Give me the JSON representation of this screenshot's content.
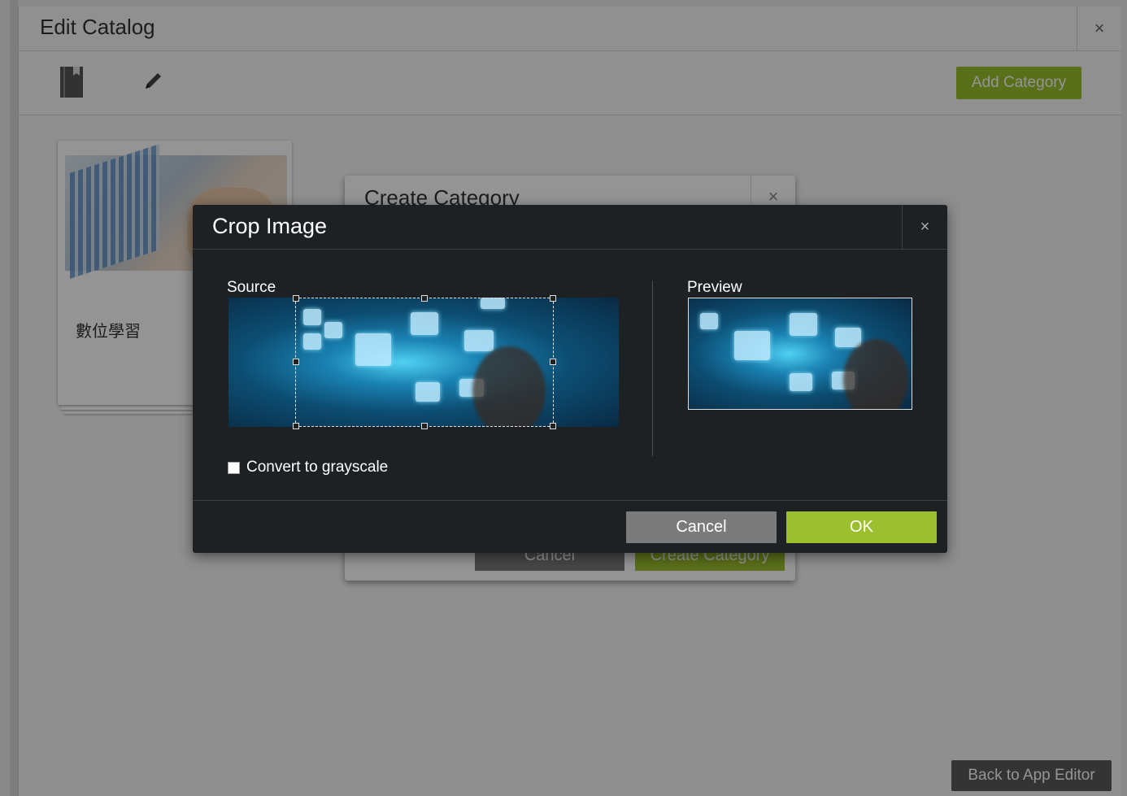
{
  "edit_catalog": {
    "title": "Edit Catalog",
    "close": "×",
    "add_category_label": "Add Category",
    "book_icon": "book-icon",
    "pencil_icon": "pencil-icon",
    "card_label": "數位學習",
    "back_label": "Back to App Editor"
  },
  "create_category": {
    "title": "Create Category",
    "close": "×",
    "cancel_label": "Cancel",
    "create_label": "Create Category"
  },
  "crop_image": {
    "title": "Crop Image",
    "close": "×",
    "source_label": "Source",
    "preview_label": "Preview",
    "grayscale_label": "Convert to grayscale",
    "grayscale_checked": false,
    "cancel_label": "Cancel",
    "ok_label": "OK"
  },
  "colors": {
    "accent_green": "#9bbf2e",
    "dialog_dark": "#1e2124",
    "button_gray": "#7b7b7b"
  }
}
